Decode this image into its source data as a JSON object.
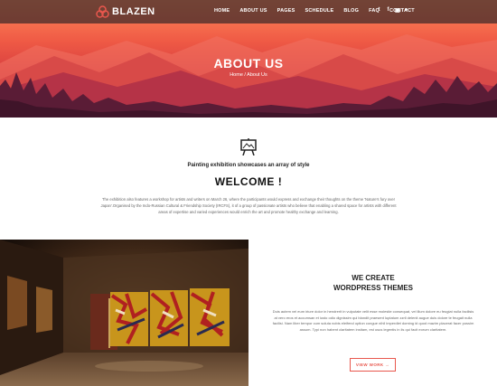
{
  "brand": {
    "name": "BLAZEN",
    "accent": "#e8574d"
  },
  "nav": {
    "items": [
      "HOME",
      "ABOUT US",
      "PAGES",
      "SCHEDULE",
      "BLOG",
      "FAQ",
      "CONTACT"
    ],
    "socials": [
      "twitter-icon",
      "facebook-icon",
      "instagram-icon",
      "dribbble-icon"
    ]
  },
  "hero": {
    "title": "ABOUT US",
    "breadcrumb": "Home / About Us"
  },
  "intro": {
    "icon": "easel-icon",
    "tagline": "Painting exhibition showcases an array of style",
    "heading": "WELCOME !",
    "text": "The exhibition also features a workshop for artists and writers on March 26, where the participants would express and exchange their thoughts on the theme 'Nature's fury over Japan'.Organised by the Indo-Russian Cultural & Friendship Society (IRCFS), it of a group of passionate artists who believe that enabling a shared space for artists with different areas of expertise and varied experiences would enrich the art and promote healthy exchange and learning."
  },
  "feature": {
    "title_line1": "WE CREATE",
    "title_line2": "WORDPRESS THEMES",
    "text": "Duis autem vel eum iriure dolor in hendrerit in vulputate velit esse molestie consequat, vel illum dolore eu feugiat nulla facilisis at vero eros et accumsan et iusto odio dignissim qui blandit praesent luptatum zzril delenit augue duis dolore te feugait nulla facilisi. Nam liber tempor cum soluta nobis eleifend option congue nihil imperdiet doming id quod mazim placerat facer possim assum. Typi non habent claritatem insitam, est usus legentis in iis qui facit eorum claritatem.",
    "button": "VIEW WORK  →"
  }
}
